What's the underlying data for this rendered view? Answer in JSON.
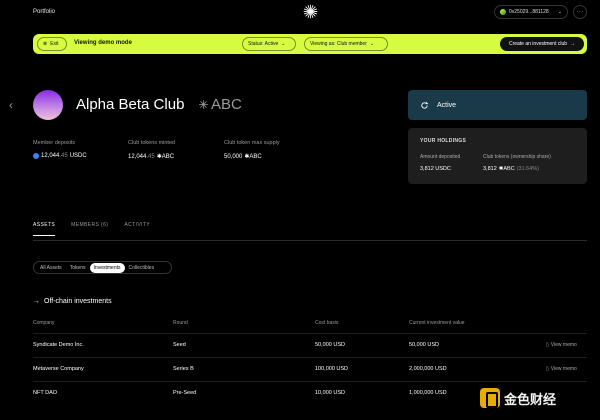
{
  "topbar": {
    "title": "Portfolio",
    "wallet_address": "0x25029...881128",
    "more_label": "···"
  },
  "banner": {
    "exit_label": "Exit",
    "mode_text": "Viewing demo mode",
    "status_label": "Status: Active",
    "viewing_label": "Viewing as: Club member",
    "create_label": "Create an investment club"
  },
  "club": {
    "name": "Alpha Beta Club",
    "symbol": "ABC",
    "status": "Active"
  },
  "stats": [
    {
      "label": "Member deposits",
      "value_main": "12,044",
      "value_dec": ".45",
      "unit": "USDC"
    },
    {
      "label": "Club tokens minted",
      "value_main": "12,044",
      "value_dec": ".45",
      "unit": "ABC"
    },
    {
      "label": "Club token max supply",
      "value_main": "50,000",
      "value_dec": "",
      "unit": "ABC"
    }
  ],
  "holdings": {
    "title": "YOUR HOLDINGS",
    "deposited_label": "Amount deposited",
    "deposited_value": "3,812 USDC",
    "tokens_label": "Club tokens (ownership share)",
    "tokens_value": "3,812",
    "tokens_unit": "ABC",
    "tokens_share": "(31.64%)"
  },
  "tabs": [
    {
      "label": "ASSETS"
    },
    {
      "label": "MEMBERS (6)"
    },
    {
      "label": "ACTIVITY"
    }
  ],
  "subtabs": [
    {
      "label": "All Assets"
    },
    {
      "label": "Tokens"
    },
    {
      "label": "Investments"
    },
    {
      "label": "Collectibles"
    }
  ],
  "section": {
    "title": "Off-chain investments"
  },
  "table": {
    "headers": [
      "Company",
      "Round",
      "Cost basis",
      "Current investment value"
    ],
    "action_label": "View memo",
    "rows": [
      {
        "company": "Syndicate Demo Inc.",
        "round": "Seed",
        "cost": "50,000 USD",
        "current": "50,000 USD"
      },
      {
        "company": "Metaverse Company",
        "round": "Series B",
        "cost": "100,000 USD",
        "current": "2,000,000 USD"
      },
      {
        "company": "NFT DAO",
        "round": "Pre-Seed",
        "cost": "10,000 USD",
        "current": "1,000,000 USD"
      }
    ]
  },
  "watermark": {
    "text": "金色财经"
  },
  "colors": {
    "banner": "#d6fb41",
    "active_card": "#1a3a4a",
    "holdings_card": "#1e1e1e",
    "avatar_start": "#8a2be2",
    "avatar_end": "#f0c0d8"
  }
}
